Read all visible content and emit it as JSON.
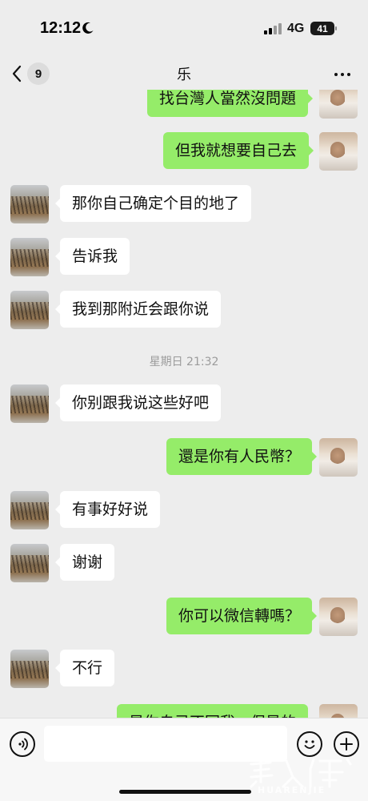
{
  "status_bar": {
    "time": "12:12",
    "network": "4G",
    "battery": "41"
  },
  "nav": {
    "back_count": "9",
    "title": "乐"
  },
  "messages": [
    {
      "side": "out",
      "text": "找台灣人當然沒問題"
    },
    {
      "side": "out",
      "text": "但我就想要自己去"
    },
    {
      "side": "in",
      "text": "那你自己确定个目的地了"
    },
    {
      "side": "in",
      "text": "告诉我"
    },
    {
      "side": "in",
      "text": "我到那附近会跟你说"
    },
    {
      "type": "timestamp",
      "text": "星期日 21:32"
    },
    {
      "side": "in",
      "text": "你别跟我说这些好吧"
    },
    {
      "side": "out",
      "text": "還是你有人民幣？"
    },
    {
      "side": "in",
      "text": "有事好好说"
    },
    {
      "side": "in",
      "text": "谢谢"
    },
    {
      "side": "out",
      "text": "你可以微信轉嗎？"
    },
    {
      "side": "in",
      "text": "不行"
    },
    {
      "side": "out",
      "text": "是你自己不回我，保是的"
    }
  ],
  "input_bar": {
    "placeholder": ""
  },
  "watermark": {
    "text": "HUARENJIE"
  },
  "colors": {
    "background": "#ededed",
    "outgoing_bubble": "#95ec69",
    "incoming_bubble": "#ffffff"
  }
}
